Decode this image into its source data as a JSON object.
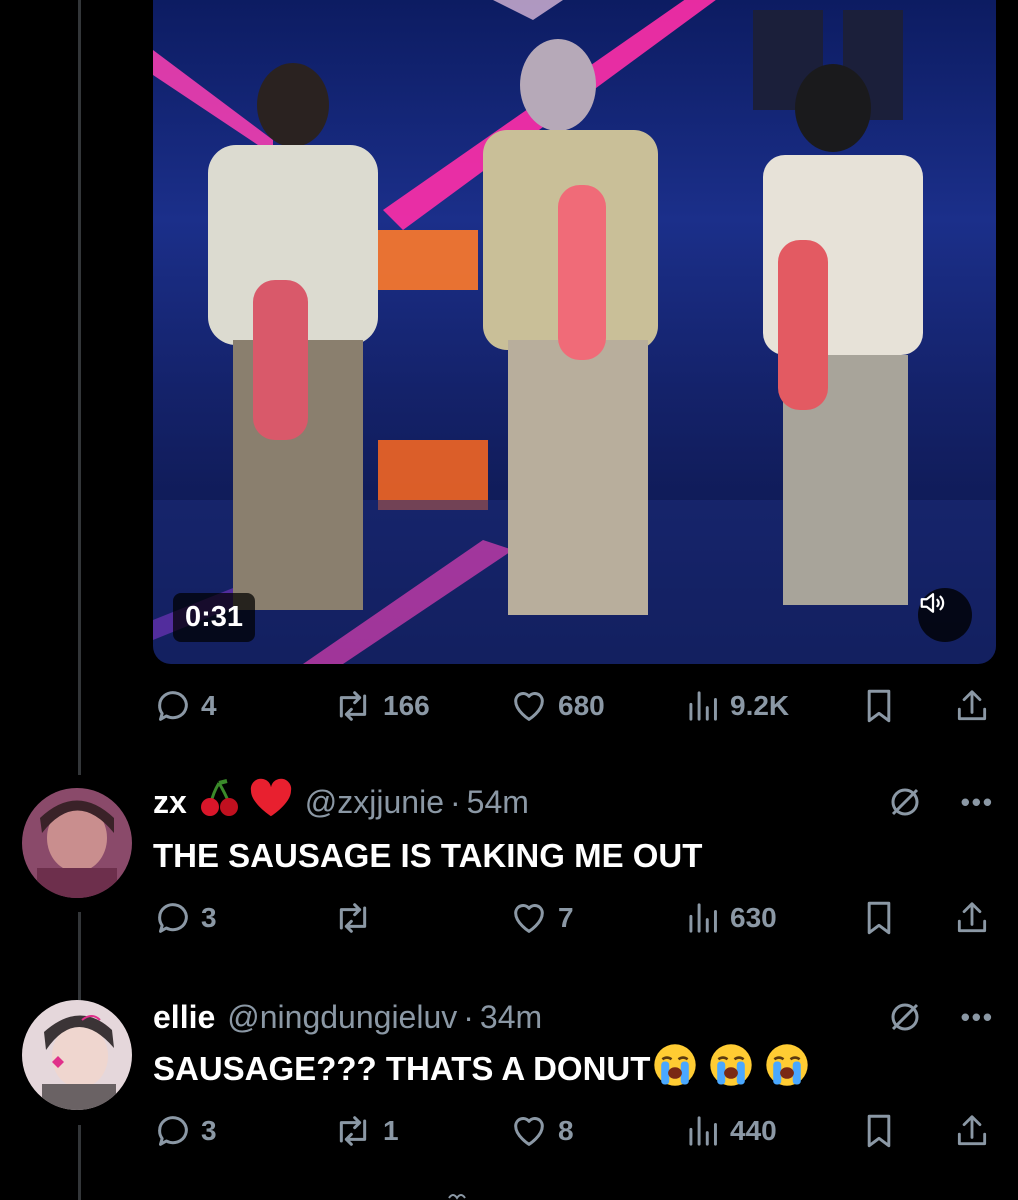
{
  "post": {
    "video": {
      "duration": "0:31",
      "volume_icon": "speaker-icon"
    },
    "stats": {
      "replies": "4",
      "reposts": "166",
      "likes": "680",
      "views": "9.2K"
    }
  },
  "replies": [
    {
      "name": "zx",
      "name_emojis": [
        "cherries",
        "red-heart"
      ],
      "handle": "@zxjjunie",
      "separator": "·",
      "time": "54m",
      "text": "THE SAUSAGE IS TAKING ME OUT",
      "text_emojis": [],
      "stats": {
        "replies": "3",
        "reposts": "",
        "likes": "7",
        "views": "630"
      },
      "avatar_color": "#8a4a6a"
    },
    {
      "name": "ellie",
      "name_emojis": [],
      "handle": "@ningdungieluv",
      "separator": "·",
      "time": "34m",
      "text": "SAUSAGE??? THATS A DONUT",
      "text_emojis": [
        "loudly-crying-face",
        "loudly-crying-face",
        "loudly-crying-face"
      ],
      "stats": {
        "replies": "3",
        "reposts": "1",
        "likes": "8",
        "views": "440"
      },
      "avatar_color": "#d9c9cf"
    }
  ],
  "colors": {
    "background": "#000000",
    "muted": "#8b98a5",
    "text": "#e7e9ea",
    "thread_line": "#333639"
  }
}
